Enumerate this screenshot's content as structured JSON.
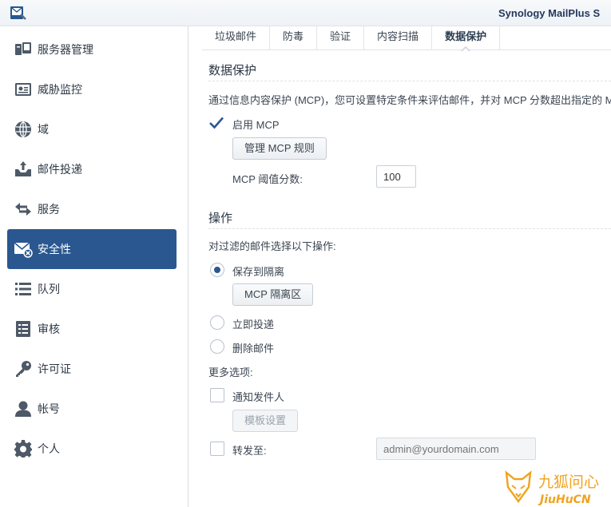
{
  "app": {
    "title": "Synology MailPlus S"
  },
  "sidebar": {
    "items": [
      {
        "label": "服务器管理",
        "icon": "server-management-icon"
      },
      {
        "label": "威胁监控",
        "icon": "threat-monitor-icon"
      },
      {
        "label": "域",
        "icon": "globe-icon"
      },
      {
        "label": "邮件投递",
        "icon": "mail-delivery-icon"
      },
      {
        "label": "服务",
        "icon": "arrows-exchange-icon"
      },
      {
        "label": "安全性",
        "icon": "mail-security-icon",
        "active": true
      },
      {
        "label": "队列",
        "icon": "list-icon"
      },
      {
        "label": "审核",
        "icon": "audit-document-icon"
      },
      {
        "label": "许可证",
        "icon": "key-icon"
      },
      {
        "label": "帐号",
        "icon": "user-icon"
      },
      {
        "label": "个人",
        "icon": "gear-icon"
      }
    ]
  },
  "tabs": [
    "垃圾邮件",
    "防毒",
    "验证",
    "内容扫描",
    "数据保护"
  ],
  "active_tab": "数据保护",
  "dlp": {
    "section_title": "数据保护",
    "description": "通过信息内容保护 (MCP)，您可设置特定条件来评估邮件，并对 MCP 分数超出指定的 MCP 阈",
    "enable_label": "启用 MCP",
    "enable_checked": true,
    "manage_rules_button": "管理 MCP 规则",
    "threshold_label": "MCP 阈值分数:",
    "threshold_value": "100"
  },
  "action": {
    "section_title": "操作",
    "description": "对过滤的邮件选择以下操作:",
    "options": [
      {
        "label": "保存到隔离",
        "checked": true
      },
      {
        "label": "立即投递",
        "checked": false
      },
      {
        "label": "删除邮件",
        "checked": false
      }
    ],
    "quarantine_button": "MCP 隔离区",
    "more_options_label": "更多选项:",
    "notify_sender_label": "通知发件人",
    "notify_sender_checked": false,
    "template_button": "模板设置",
    "forward_label": "转发至:",
    "forward_checked": false,
    "forward_placeholder": "admin@yourdomain.com"
  },
  "watermark": {
    "text_cn": "九狐问心",
    "text_en": "JiuHuCN"
  },
  "colors": {
    "accent": "#2a5790",
    "brand_title": "#23395d",
    "watermark": "#f0a31e"
  }
}
